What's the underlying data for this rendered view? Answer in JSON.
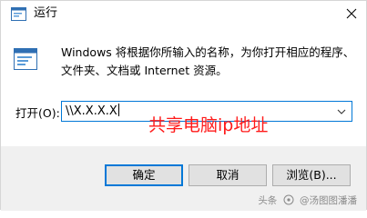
{
  "window": {
    "title": "运行"
  },
  "dialog": {
    "description_line1": "Windows 将根据你所输入的名称，为你打开相应的程序、",
    "description_line2": "文件夹、文档或 Internet 资源。",
    "open_label": "打开(O):",
    "open_value": "\\\\X.X.X.X"
  },
  "annotation": {
    "text": "共享电脑ip地址",
    "color": "#ff1a1a"
  },
  "buttons": {
    "ok": "确定",
    "cancel": "取消",
    "browse": "浏览(B)..."
  },
  "watermark": {
    "prefix": "头条",
    "handle": "@汤图图潘潘"
  },
  "icons": {
    "title_icon": "run-app-icon",
    "main_icon": "run-app-icon",
    "close": "close-icon",
    "dropdown": "chevron-down-icon"
  },
  "colors": {
    "accent": "#0078d7",
    "footer_bg": "#f0f0f0"
  }
}
